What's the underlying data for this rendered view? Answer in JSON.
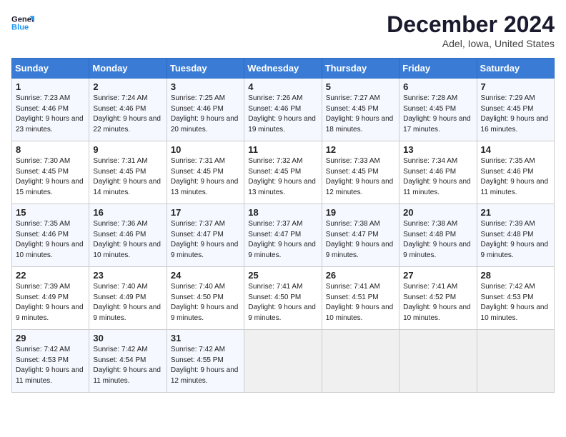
{
  "header": {
    "logo_line1": "General",
    "logo_line2": "Blue",
    "month": "December 2024",
    "location": "Adel, Iowa, United States"
  },
  "weekdays": [
    "Sunday",
    "Monday",
    "Tuesday",
    "Wednesday",
    "Thursday",
    "Friday",
    "Saturday"
  ],
  "weeks": [
    [
      {
        "day": "1",
        "sunrise": "7:23 AM",
        "sunset": "4:46 PM",
        "daylight": "9 hours and 23 minutes."
      },
      {
        "day": "2",
        "sunrise": "7:24 AM",
        "sunset": "4:46 PM",
        "daylight": "9 hours and 22 minutes."
      },
      {
        "day": "3",
        "sunrise": "7:25 AM",
        "sunset": "4:46 PM",
        "daylight": "9 hours and 20 minutes."
      },
      {
        "day": "4",
        "sunrise": "7:26 AM",
        "sunset": "4:46 PM",
        "daylight": "9 hours and 19 minutes."
      },
      {
        "day": "5",
        "sunrise": "7:27 AM",
        "sunset": "4:45 PM",
        "daylight": "9 hours and 18 minutes."
      },
      {
        "day": "6",
        "sunrise": "7:28 AM",
        "sunset": "4:45 PM",
        "daylight": "9 hours and 17 minutes."
      },
      {
        "day": "7",
        "sunrise": "7:29 AM",
        "sunset": "4:45 PM",
        "daylight": "9 hours and 16 minutes."
      }
    ],
    [
      {
        "day": "8",
        "sunrise": "7:30 AM",
        "sunset": "4:45 PM",
        "daylight": "9 hours and 15 minutes."
      },
      {
        "day": "9",
        "sunrise": "7:31 AM",
        "sunset": "4:45 PM",
        "daylight": "9 hours and 14 minutes."
      },
      {
        "day": "10",
        "sunrise": "7:31 AM",
        "sunset": "4:45 PM",
        "daylight": "9 hours and 13 minutes."
      },
      {
        "day": "11",
        "sunrise": "7:32 AM",
        "sunset": "4:45 PM",
        "daylight": "9 hours and 13 minutes."
      },
      {
        "day": "12",
        "sunrise": "7:33 AM",
        "sunset": "4:45 PM",
        "daylight": "9 hours and 12 minutes."
      },
      {
        "day": "13",
        "sunrise": "7:34 AM",
        "sunset": "4:46 PM",
        "daylight": "9 hours and 11 minutes."
      },
      {
        "day": "14",
        "sunrise": "7:35 AM",
        "sunset": "4:46 PM",
        "daylight": "9 hours and 11 minutes."
      }
    ],
    [
      {
        "day": "15",
        "sunrise": "7:35 AM",
        "sunset": "4:46 PM",
        "daylight": "9 hours and 10 minutes."
      },
      {
        "day": "16",
        "sunrise": "7:36 AM",
        "sunset": "4:46 PM",
        "daylight": "9 hours and 10 minutes."
      },
      {
        "day": "17",
        "sunrise": "7:37 AM",
        "sunset": "4:47 PM",
        "daylight": "9 hours and 9 minutes."
      },
      {
        "day": "18",
        "sunrise": "7:37 AM",
        "sunset": "4:47 PM",
        "daylight": "9 hours and 9 minutes."
      },
      {
        "day": "19",
        "sunrise": "7:38 AM",
        "sunset": "4:47 PM",
        "daylight": "9 hours and 9 minutes."
      },
      {
        "day": "20",
        "sunrise": "7:38 AM",
        "sunset": "4:48 PM",
        "daylight": "9 hours and 9 minutes."
      },
      {
        "day": "21",
        "sunrise": "7:39 AM",
        "sunset": "4:48 PM",
        "daylight": "9 hours and 9 minutes."
      }
    ],
    [
      {
        "day": "22",
        "sunrise": "7:39 AM",
        "sunset": "4:49 PM",
        "daylight": "9 hours and 9 minutes."
      },
      {
        "day": "23",
        "sunrise": "7:40 AM",
        "sunset": "4:49 PM",
        "daylight": "9 hours and 9 minutes."
      },
      {
        "day": "24",
        "sunrise": "7:40 AM",
        "sunset": "4:50 PM",
        "daylight": "9 hours and 9 minutes."
      },
      {
        "day": "25",
        "sunrise": "7:41 AM",
        "sunset": "4:50 PM",
        "daylight": "9 hours and 9 minutes."
      },
      {
        "day": "26",
        "sunrise": "7:41 AM",
        "sunset": "4:51 PM",
        "daylight": "9 hours and 10 minutes."
      },
      {
        "day": "27",
        "sunrise": "7:41 AM",
        "sunset": "4:52 PM",
        "daylight": "9 hours and 10 minutes."
      },
      {
        "day": "28",
        "sunrise": "7:42 AM",
        "sunset": "4:53 PM",
        "daylight": "9 hours and 10 minutes."
      }
    ],
    [
      {
        "day": "29",
        "sunrise": "7:42 AM",
        "sunset": "4:53 PM",
        "daylight": "9 hours and 11 minutes."
      },
      {
        "day": "30",
        "sunrise": "7:42 AM",
        "sunset": "4:54 PM",
        "daylight": "9 hours and 11 minutes."
      },
      {
        "day": "31",
        "sunrise": "7:42 AM",
        "sunset": "4:55 PM",
        "daylight": "9 hours and 12 minutes."
      },
      null,
      null,
      null,
      null
    ]
  ]
}
